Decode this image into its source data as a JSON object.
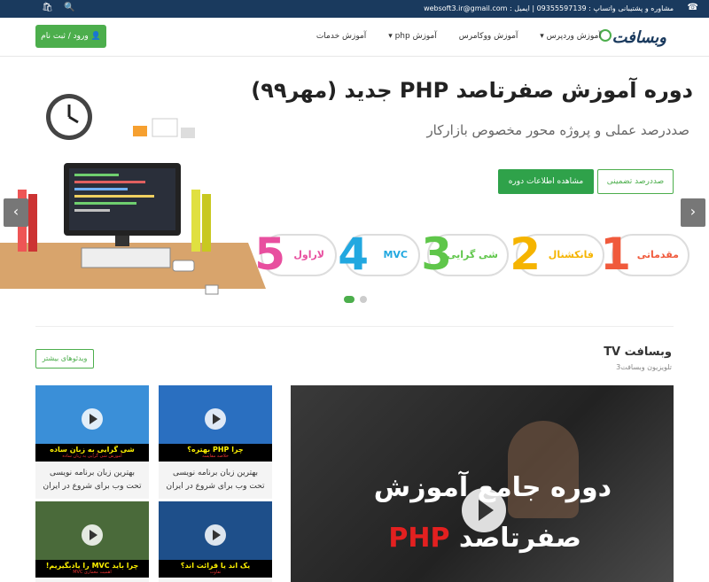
{
  "topbar": {
    "contact": "مشاوره و پشتیبانی واتساپ : 09355597139 | ایمیل : websoft3.ir@gmail.com",
    "phone_icon": "☎",
    "cart_icon": "🛍",
    "search_icon": "🔍"
  },
  "header": {
    "logo": "وبسافت",
    "login_label": "ورود / ثبت نام",
    "menu": [
      "آموزش وردپرس ▾",
      "آموزش ووکامرس",
      "آموزش php ▾",
      "آموزش خدمات"
    ]
  },
  "slider": {
    "title": "دوره آموزش صفرتاصد PHP جدید (مهر۹۹)",
    "subtitle": "صددرصد عملی و پروژه محور مخصوص بازارکار",
    "btn_guarantee": "صددرصد تضمینی",
    "btn_info": "مشاهده اطلاعات دوره",
    "levels": [
      {
        "num": "1",
        "label": "مقدماتی",
        "color": "#f05a3c"
      },
      {
        "num": "2",
        "label": "فانکشنال",
        "color": "#f5b400"
      },
      {
        "num": "3",
        "label": "شی گرایی",
        "color": "#5fc64a"
      },
      {
        "num": "4",
        "label": "MVC",
        "color": "#22a8e0"
      },
      {
        "num": "5",
        "label": "لاراول",
        "color": "#e84f9f"
      }
    ],
    "prev_icon": "‹",
    "next_icon": "›"
  },
  "tv": {
    "title": "وبسافت TV",
    "subtitle": "تلویزیون وبسافت3",
    "more_label": "ویدئوهای بیشتر"
  },
  "cards": [
    {
      "caption": "چرا PHP بهتره؟",
      "caption_sub": "خلاصه مقایسه",
      "title": "بهترین زبان برنامه نویسی تحت وب برای شروع در ایران",
      "bg": "#2a6fc0"
    },
    {
      "caption": "شی گرایی به زبان ساده",
      "caption_sub": "آموزش شی گرایی به زبان ساده",
      "title": "بهترین زبان برنامه نویسی تحت وب برای شروع در ایران",
      "bg": "#3a8fd8"
    },
    {
      "caption": "یک اند  یا  قرائت اند؟",
      "caption_sub": "تفاوت",
      "title": "",
      "bg": "#1e4f8a"
    },
    {
      "caption": "چرا باید MVC را یادبگیریم!",
      "caption_sub": "اهمیت معماری MVC",
      "title": "",
      "bg": "#4a6a3a"
    }
  ],
  "video": {
    "line1": "دوره جامع آموزش",
    "line2_prefix": "صفرتاصد",
    "line2_php": "PHP"
  }
}
